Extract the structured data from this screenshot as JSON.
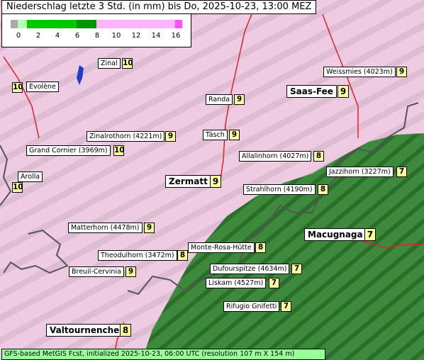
{
  "title": "Niederschlag letzte 3 Std. (in mm) bis Do, 2025-10-23, 13:00 MEZ",
  "legend": {
    "ticks": [
      "0",
      "2",
      "4",
      "6",
      "8",
      "10",
      "12",
      "14",
      "16"
    ],
    "colors": [
      "#aaaaaa",
      "#b4ffb4",
      "#00c800",
      "#009600",
      "#ffb4ff",
      "#ff50ff"
    ]
  },
  "colors": {
    "map_pink": "#efcbe3",
    "map_green": "#3d8a3d",
    "border": "#555555",
    "river": "#dd2222",
    "lake": "#1e3ccc"
  },
  "places": [
    {
      "name": "Zinal",
      "value": "10"
    },
    {
      "name": "Evolène",
      "value": "10"
    },
    {
      "name": "Weissmies (4023m)",
      "value": "9"
    },
    {
      "name": "Saas-Fee",
      "value": "9"
    },
    {
      "name": "Randa",
      "value": "9"
    },
    {
      "name": "Täsch",
      "value": "9"
    },
    {
      "name": "Zinalrothorn (4221m)",
      "value": "9"
    },
    {
      "name": "Grand Cornier (3969m)",
      "value": "10"
    },
    {
      "name": "Allalinhorn (4027m)",
      "value": "8"
    },
    {
      "name": "Jazzihorn (3227m)",
      "value": "7"
    },
    {
      "name": "Arolla",
      "value": "10"
    },
    {
      "name": "Zermatt",
      "value": "9"
    },
    {
      "name": "Strahlhorn (4190m)",
      "value": "8"
    },
    {
      "name": "Matterhorn (4478m)",
      "value": "9"
    },
    {
      "name": "Macugnaga",
      "value": "7"
    },
    {
      "name": "Monte-Rosa-Hütte",
      "value": "8"
    },
    {
      "name": "Theodulhorn (3472m)",
      "value": "8"
    },
    {
      "name": "Dufourspitze (4634m)",
      "value": "7"
    },
    {
      "name": "Breuil-Cervinia",
      "value": "9"
    },
    {
      "name": "Liskam (4527m)",
      "value": "7"
    },
    {
      "name": "Rifugio Gnifetti",
      "value": "7"
    },
    {
      "name": "Valtournenche",
      "value": "8"
    }
  ],
  "footer": "GFS-based MetGIS Fcst, initialized 2025-10-23, 06:00 UTC  (resolution 107 m X 154 m)"
}
